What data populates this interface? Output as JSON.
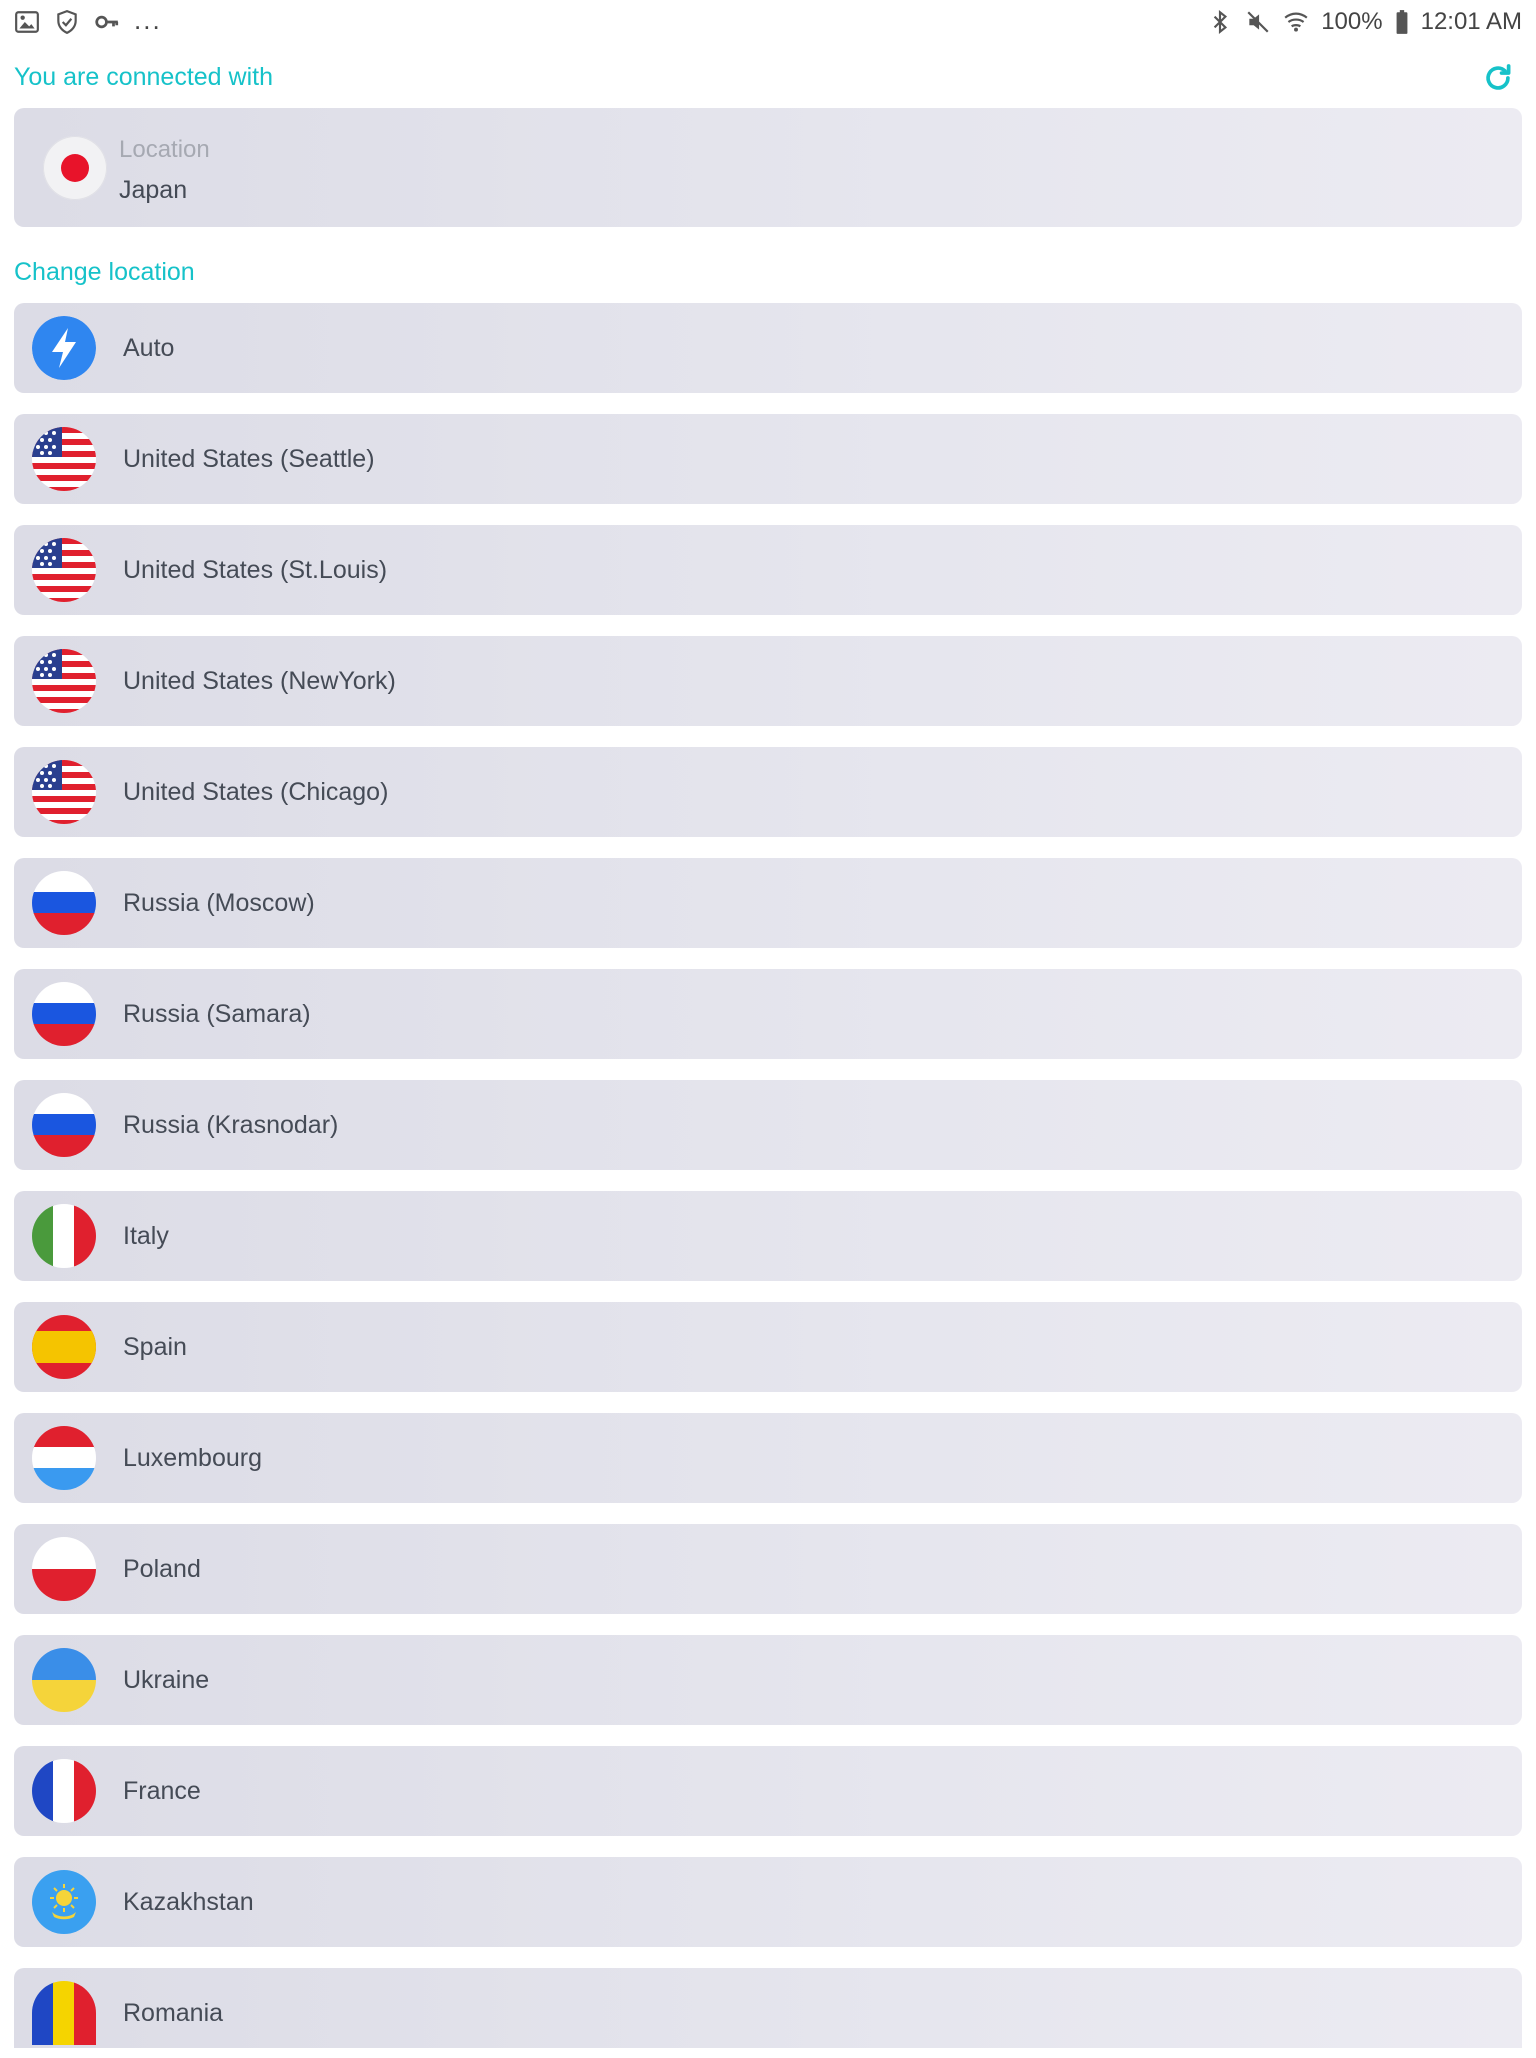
{
  "status_bar": {
    "left_icons": [
      "image-icon",
      "shield-check-icon",
      "key-icon"
    ],
    "more": "...",
    "right_icons": [
      "bluetooth-icon",
      "mute-icon",
      "wifi-icon"
    ],
    "battery": "100%",
    "time": "12:01 AM"
  },
  "connected": {
    "heading": "You are connected with",
    "label": "Location",
    "value": "Japan",
    "refresh_icon": "refresh-icon",
    "accent_color": "#16c2c9"
  },
  "change": {
    "heading": "Change location"
  },
  "locations": [
    {
      "name": "Auto",
      "flag": "auto"
    },
    {
      "name": "United States (Seattle)",
      "flag": "us"
    },
    {
      "name": "United States (St.Louis)",
      "flag": "us"
    },
    {
      "name": "United States (NewYork)",
      "flag": "us"
    },
    {
      "name": "United States (Chicago)",
      "flag": "us"
    },
    {
      "name": "Russia (Moscow)",
      "flag": "ru"
    },
    {
      "name": "Russia (Samara)",
      "flag": "ru"
    },
    {
      "name": "Russia (Krasnodar)",
      "flag": "ru"
    },
    {
      "name": "Italy",
      "flag": "it"
    },
    {
      "name": "Spain",
      "flag": "es"
    },
    {
      "name": "Luxembourg",
      "flag": "lu"
    },
    {
      "name": "Poland",
      "flag": "pl"
    },
    {
      "name": "Ukraine",
      "flag": "ua"
    },
    {
      "name": "France",
      "flag": "fr"
    },
    {
      "name": "Kazakhstan",
      "flag": "kz"
    },
    {
      "name": "Romania",
      "flag": "ro"
    }
  ]
}
